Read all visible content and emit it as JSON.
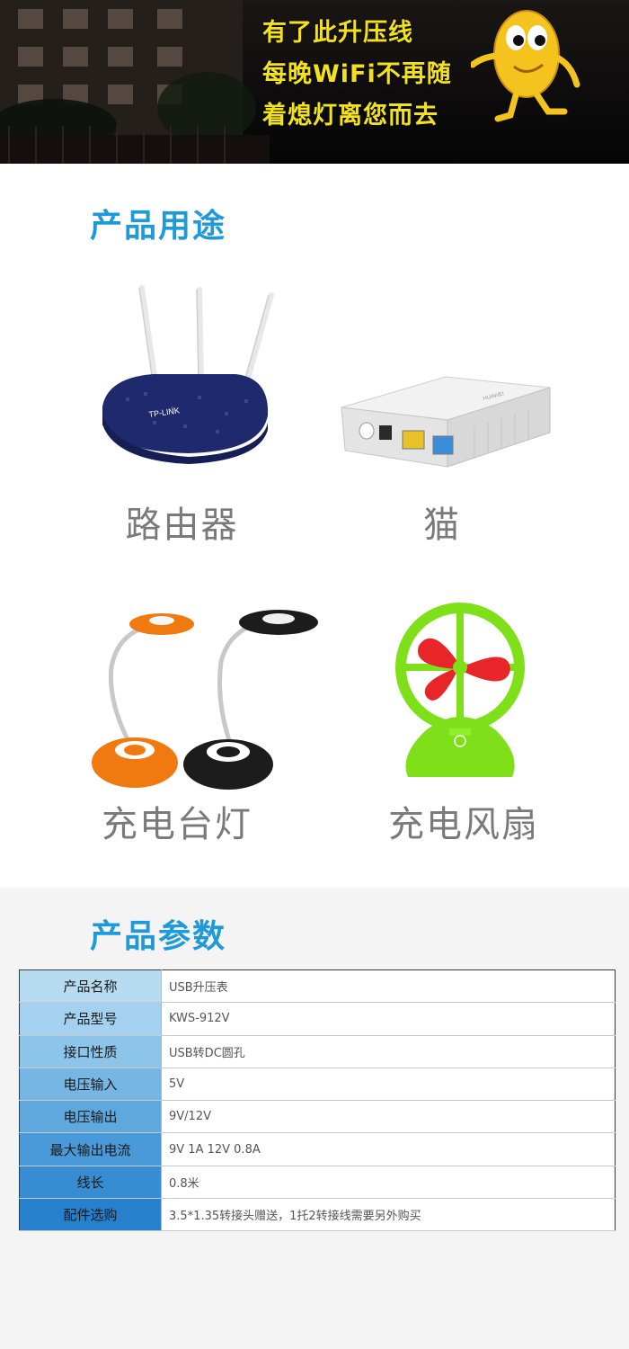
{
  "banner": {
    "lines": [
      "有了此升压线",
      "每晚WiFi不再随",
      "着熄灯离您而去"
    ]
  },
  "uses": {
    "title": "产品用途",
    "items": [
      "路由器",
      "猫",
      "充电台灯",
      "充电风扇"
    ]
  },
  "params": {
    "title": "产品参数",
    "rows": [
      {
        "label": "产品名称",
        "value": "USB升压表",
        "color": "#b7dcf2"
      },
      {
        "label": "产品型号",
        "value": "KWS-912V",
        "color": "#a3d1ef"
      },
      {
        "label": "接口性质",
        "value": "USB转DC圆孔",
        "color": "#8cc4ea"
      },
      {
        "label": "电压输入",
        "value": "5V",
        "color": "#75b6e4"
      },
      {
        "label": "电压输出",
        "value": "9V/12V",
        "color": "#5fa8de"
      },
      {
        "label": "最大输出电流",
        "value": "9V 1A      12V 0.8A",
        "color": "#4a99d8"
      },
      {
        "label": "线长",
        "value": "0.8米",
        "color": "#378cd2"
      },
      {
        "label": "配件选购",
        "value": "3.5*1.35转接头赠送，1托2转接线需要另外购买",
        "color": "#2680cc"
      }
    ]
  },
  "colors": {
    "accent": "#1f9ad9",
    "banner_text": "#f3e21a"
  }
}
